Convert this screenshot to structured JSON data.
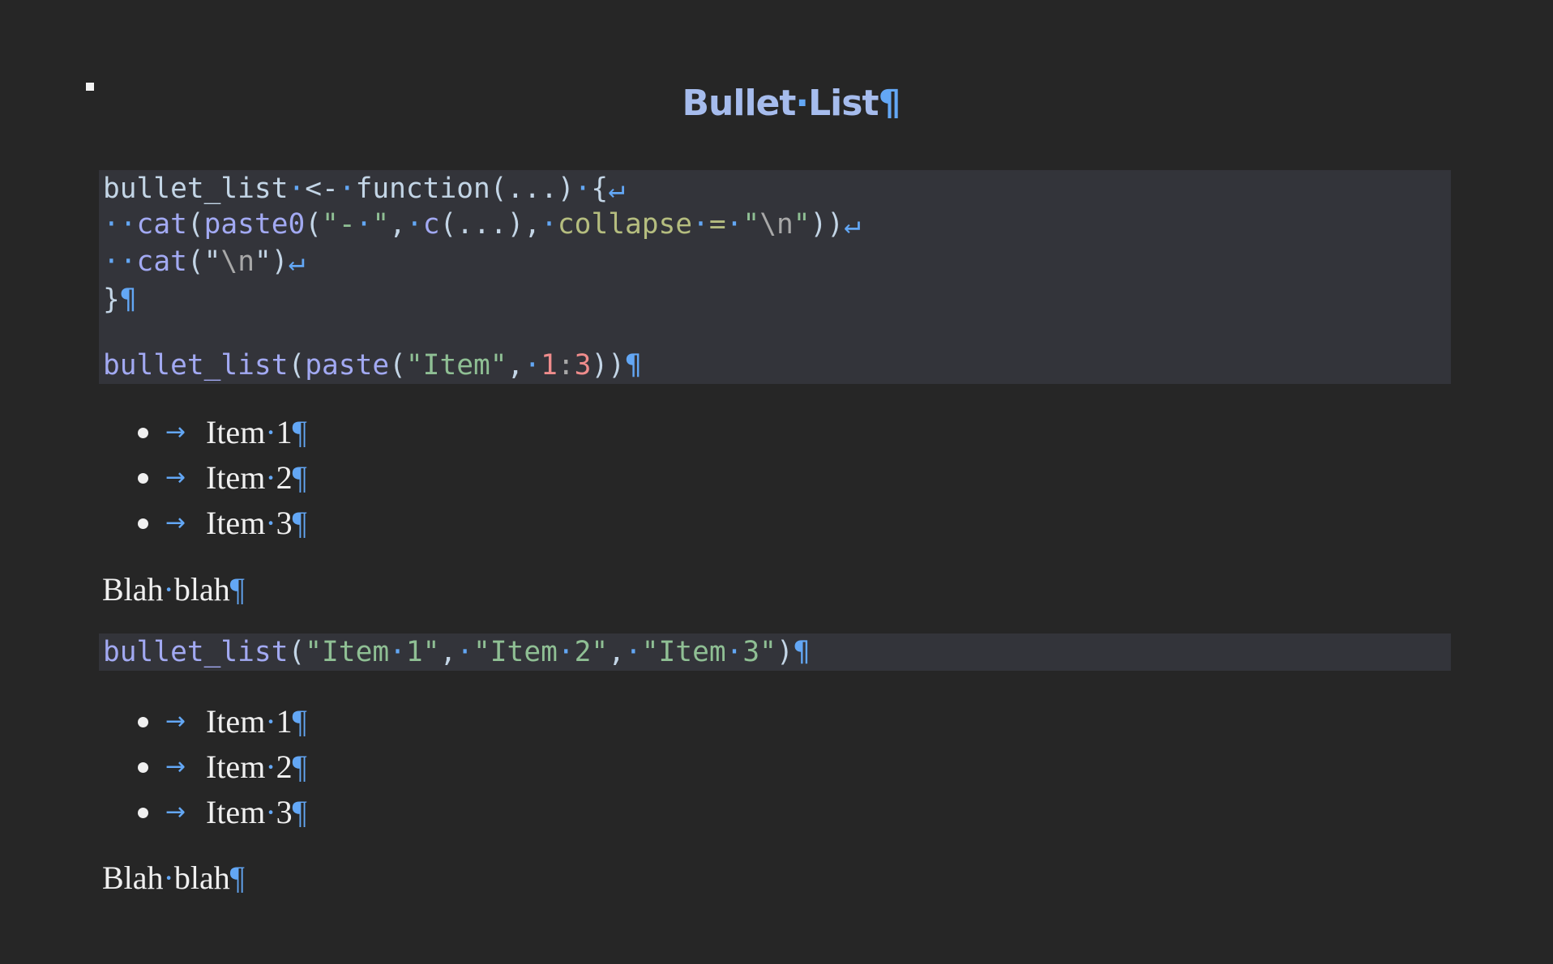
{
  "document": {
    "title": {
      "text_a": "Bullet",
      "space": "·",
      "text_b": "List",
      "eol": "¶"
    },
    "colors": {
      "background": "#262626",
      "code_background": "#33343a",
      "heading": "#a6bced",
      "formatting_marks": "#63a7f5",
      "body_text": "#f0f0f0",
      "code_default": "#c3d5e6",
      "code_function": "#a2a9f2",
      "code_string": "#8fbf94",
      "code_number": "#ef8c8c",
      "code_argument": "#b5bd7f",
      "code_escape": "#a8a8a8"
    },
    "code_block_1": {
      "lines": [
        [
          {
            "t": "bullet_list",
            "k": "punc"
          },
          {
            "t": "·",
            "k": "ws"
          },
          {
            "t": "<-",
            "k": "punc"
          },
          {
            "t": "·",
            "k": "ws"
          },
          {
            "t": "function(...)",
            "k": "punc"
          },
          {
            "t": "·",
            "k": "ws"
          },
          {
            "t": "{",
            "k": "punc"
          },
          {
            "t": "↵",
            "k": "eol"
          }
        ],
        [
          {
            "t": "··",
            "k": "ws"
          },
          {
            "t": "cat",
            "k": "fn"
          },
          {
            "t": "(",
            "k": "punc"
          },
          {
            "t": "paste0",
            "k": "fn"
          },
          {
            "t": "(",
            "k": "punc"
          },
          {
            "t": "\"-",
            "k": "str"
          },
          {
            "t": "·",
            "k": "ws"
          },
          {
            "t": "\"",
            "k": "str"
          },
          {
            "t": ",",
            "k": "punc"
          },
          {
            "t": "·",
            "k": "ws"
          },
          {
            "t": "c",
            "k": "fn"
          },
          {
            "t": "(...),",
            "k": "punc"
          },
          {
            "t": "·",
            "k": "ws"
          },
          {
            "t": "collapse",
            "k": "arg"
          },
          {
            "t": "·",
            "k": "ws"
          },
          {
            "t": "=",
            "k": "arg"
          },
          {
            "t": "·",
            "k": "ws"
          },
          {
            "t": "\"",
            "k": "str"
          },
          {
            "t": "\\n",
            "k": "esc"
          },
          {
            "t": "\"",
            "k": "str"
          },
          {
            "t": "))",
            "k": "punc"
          },
          {
            "t": "↵",
            "k": "eol"
          }
        ],
        [
          {
            "t": "··",
            "k": "ws"
          },
          {
            "t": "cat",
            "k": "fn"
          },
          {
            "t": "(",
            "k": "punc"
          },
          {
            "t": "\"",
            "k": "punc"
          },
          {
            "t": "\\n",
            "k": "esc"
          },
          {
            "t": "\"",
            "k": "punc"
          },
          {
            "t": ")",
            "k": "punc"
          },
          {
            "t": "↵",
            "k": "eol"
          }
        ],
        [
          {
            "t": "}",
            "k": "punc"
          },
          {
            "t": "¶",
            "k": "eol"
          }
        ],
        [
          {
            "t": "bullet_list",
            "k": "fn"
          },
          {
            "t": "(",
            "k": "punc"
          },
          {
            "t": "paste",
            "k": "fn"
          },
          {
            "t": "(",
            "k": "punc"
          },
          {
            "t": "\"Item\"",
            "k": "str"
          },
          {
            "t": ",",
            "k": "punc"
          },
          {
            "t": "·",
            "k": "ws"
          },
          {
            "t": "1",
            "k": "num"
          },
          {
            "t": ":",
            "k": "esc"
          },
          {
            "t": "3",
            "k": "num"
          },
          {
            "t": "))",
            "k": "punc"
          },
          {
            "t": "¶",
            "k": "eol"
          }
        ]
      ]
    },
    "list_1": {
      "bullet_glyph": "•",
      "tab_mark": "→",
      "items": [
        {
          "word": "Item",
          "space": "·",
          "num": "1",
          "eol": "¶"
        },
        {
          "word": "Item",
          "space": "·",
          "num": "2",
          "eol": "¶"
        },
        {
          "word": "Item",
          "space": "·",
          "num": "3",
          "eol": "¶"
        }
      ]
    },
    "paragraph_1": {
      "word_a": "Blah",
      "space": "·",
      "word_b": "blah",
      "eol": "¶"
    },
    "code_block_2": {
      "lines": [
        [
          {
            "t": "bullet_list",
            "k": "fn"
          },
          {
            "t": "(",
            "k": "punc"
          },
          {
            "t": "\"Item",
            "k": "str"
          },
          {
            "t": "·",
            "k": "ws"
          },
          {
            "t": "1\"",
            "k": "str"
          },
          {
            "t": ",",
            "k": "punc"
          },
          {
            "t": "·",
            "k": "ws"
          },
          {
            "t": "\"Item",
            "k": "str"
          },
          {
            "t": "·",
            "k": "ws"
          },
          {
            "t": "2\"",
            "k": "str"
          },
          {
            "t": ",",
            "k": "punc"
          },
          {
            "t": "·",
            "k": "ws"
          },
          {
            "t": "\"Item",
            "k": "str"
          },
          {
            "t": "·",
            "k": "ws"
          },
          {
            "t": "3\"",
            "k": "str"
          },
          {
            "t": ")",
            "k": "punc"
          },
          {
            "t": "¶",
            "k": "eol"
          }
        ]
      ]
    },
    "list_2": {
      "tab_mark": "→",
      "items": [
        {
          "word": "Item",
          "space": "·",
          "num": "1",
          "eol": "¶"
        },
        {
          "word": "Item",
          "space": "·",
          "num": "2",
          "eol": "¶"
        },
        {
          "word": "Item",
          "space": "·",
          "num": "3",
          "eol": "¶"
        }
      ]
    },
    "paragraph_2": {
      "word_a": "Blah",
      "space": "·",
      "word_b": "blah",
      "eol": "¶"
    }
  }
}
